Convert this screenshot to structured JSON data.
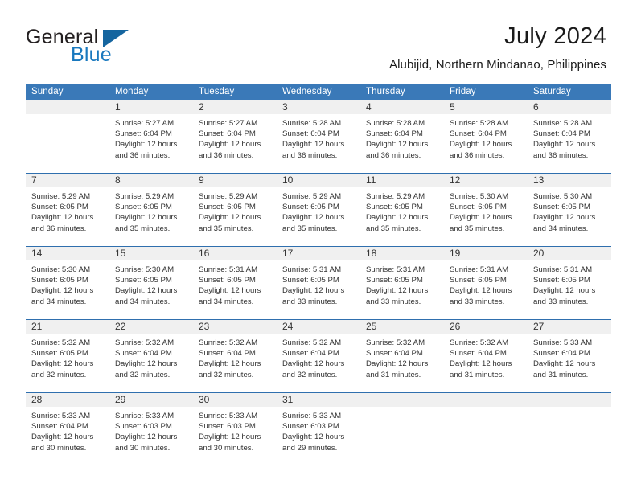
{
  "logo": {
    "word_general": "General",
    "word_blue": "Blue"
  },
  "header": {
    "title": "July 2024",
    "subtitle": "Alubijid, Northern Mindanao, Philippines"
  },
  "colors": {
    "header_blue": "#3a79b8",
    "week_rule_blue": "#2f6fae",
    "day_band_gray": "#f0f0f0",
    "logo_blue": "#1878be"
  },
  "calendar": {
    "weekday_headers": [
      "Sunday",
      "Monday",
      "Tuesday",
      "Wednesday",
      "Thursday",
      "Friday",
      "Saturday"
    ],
    "weeks": [
      [
        {
          "day": "",
          "lines": []
        },
        {
          "day": "1",
          "lines": [
            "Sunrise: 5:27 AM",
            "Sunset: 6:04 PM",
            "Daylight: 12 hours",
            "and 36 minutes."
          ]
        },
        {
          "day": "2",
          "lines": [
            "Sunrise: 5:27 AM",
            "Sunset: 6:04 PM",
            "Daylight: 12 hours",
            "and 36 minutes."
          ]
        },
        {
          "day": "3",
          "lines": [
            "Sunrise: 5:28 AM",
            "Sunset: 6:04 PM",
            "Daylight: 12 hours",
            "and 36 minutes."
          ]
        },
        {
          "day": "4",
          "lines": [
            "Sunrise: 5:28 AM",
            "Sunset: 6:04 PM",
            "Daylight: 12 hours",
            "and 36 minutes."
          ]
        },
        {
          "day": "5",
          "lines": [
            "Sunrise: 5:28 AM",
            "Sunset: 6:04 PM",
            "Daylight: 12 hours",
            "and 36 minutes."
          ]
        },
        {
          "day": "6",
          "lines": [
            "Sunrise: 5:28 AM",
            "Sunset: 6:04 PM",
            "Daylight: 12 hours",
            "and 36 minutes."
          ]
        }
      ],
      [
        {
          "day": "7",
          "lines": [
            "Sunrise: 5:29 AM",
            "Sunset: 6:05 PM",
            "Daylight: 12 hours",
            "and 36 minutes."
          ]
        },
        {
          "day": "8",
          "lines": [
            "Sunrise: 5:29 AM",
            "Sunset: 6:05 PM",
            "Daylight: 12 hours",
            "and 35 minutes."
          ]
        },
        {
          "day": "9",
          "lines": [
            "Sunrise: 5:29 AM",
            "Sunset: 6:05 PM",
            "Daylight: 12 hours",
            "and 35 minutes."
          ]
        },
        {
          "day": "10",
          "lines": [
            "Sunrise: 5:29 AM",
            "Sunset: 6:05 PM",
            "Daylight: 12 hours",
            "and 35 minutes."
          ]
        },
        {
          "day": "11",
          "lines": [
            "Sunrise: 5:29 AM",
            "Sunset: 6:05 PM",
            "Daylight: 12 hours",
            "and 35 minutes."
          ]
        },
        {
          "day": "12",
          "lines": [
            "Sunrise: 5:30 AM",
            "Sunset: 6:05 PM",
            "Daylight: 12 hours",
            "and 35 minutes."
          ]
        },
        {
          "day": "13",
          "lines": [
            "Sunrise: 5:30 AM",
            "Sunset: 6:05 PM",
            "Daylight: 12 hours",
            "and 34 minutes."
          ]
        }
      ],
      [
        {
          "day": "14",
          "lines": [
            "Sunrise: 5:30 AM",
            "Sunset: 6:05 PM",
            "Daylight: 12 hours",
            "and 34 minutes."
          ]
        },
        {
          "day": "15",
          "lines": [
            "Sunrise: 5:30 AM",
            "Sunset: 6:05 PM",
            "Daylight: 12 hours",
            "and 34 minutes."
          ]
        },
        {
          "day": "16",
          "lines": [
            "Sunrise: 5:31 AM",
            "Sunset: 6:05 PM",
            "Daylight: 12 hours",
            "and 34 minutes."
          ]
        },
        {
          "day": "17",
          "lines": [
            "Sunrise: 5:31 AM",
            "Sunset: 6:05 PM",
            "Daylight: 12 hours",
            "and 33 minutes."
          ]
        },
        {
          "day": "18",
          "lines": [
            "Sunrise: 5:31 AM",
            "Sunset: 6:05 PM",
            "Daylight: 12 hours",
            "and 33 minutes."
          ]
        },
        {
          "day": "19",
          "lines": [
            "Sunrise: 5:31 AM",
            "Sunset: 6:05 PM",
            "Daylight: 12 hours",
            "and 33 minutes."
          ]
        },
        {
          "day": "20",
          "lines": [
            "Sunrise: 5:31 AM",
            "Sunset: 6:05 PM",
            "Daylight: 12 hours",
            "and 33 minutes."
          ]
        }
      ],
      [
        {
          "day": "21",
          "lines": [
            "Sunrise: 5:32 AM",
            "Sunset: 6:05 PM",
            "Daylight: 12 hours",
            "and 32 minutes."
          ]
        },
        {
          "day": "22",
          "lines": [
            "Sunrise: 5:32 AM",
            "Sunset: 6:04 PM",
            "Daylight: 12 hours",
            "and 32 minutes."
          ]
        },
        {
          "day": "23",
          "lines": [
            "Sunrise: 5:32 AM",
            "Sunset: 6:04 PM",
            "Daylight: 12 hours",
            "and 32 minutes."
          ]
        },
        {
          "day": "24",
          "lines": [
            "Sunrise: 5:32 AM",
            "Sunset: 6:04 PM",
            "Daylight: 12 hours",
            "and 32 minutes."
          ]
        },
        {
          "day": "25",
          "lines": [
            "Sunrise: 5:32 AM",
            "Sunset: 6:04 PM",
            "Daylight: 12 hours",
            "and 31 minutes."
          ]
        },
        {
          "day": "26",
          "lines": [
            "Sunrise: 5:32 AM",
            "Sunset: 6:04 PM",
            "Daylight: 12 hours",
            "and 31 minutes."
          ]
        },
        {
          "day": "27",
          "lines": [
            "Sunrise: 5:33 AM",
            "Sunset: 6:04 PM",
            "Daylight: 12 hours",
            "and 31 minutes."
          ]
        }
      ],
      [
        {
          "day": "28",
          "lines": [
            "Sunrise: 5:33 AM",
            "Sunset: 6:04 PM",
            "Daylight: 12 hours",
            "and 30 minutes."
          ]
        },
        {
          "day": "29",
          "lines": [
            "Sunrise: 5:33 AM",
            "Sunset: 6:03 PM",
            "Daylight: 12 hours",
            "and 30 minutes."
          ]
        },
        {
          "day": "30",
          "lines": [
            "Sunrise: 5:33 AM",
            "Sunset: 6:03 PM",
            "Daylight: 12 hours",
            "and 30 minutes."
          ]
        },
        {
          "day": "31",
          "lines": [
            "Sunrise: 5:33 AM",
            "Sunset: 6:03 PM",
            "Daylight: 12 hours",
            "and 29 minutes."
          ]
        },
        {
          "day": "",
          "lines": []
        },
        {
          "day": "",
          "lines": []
        },
        {
          "day": "",
          "lines": []
        }
      ]
    ]
  }
}
